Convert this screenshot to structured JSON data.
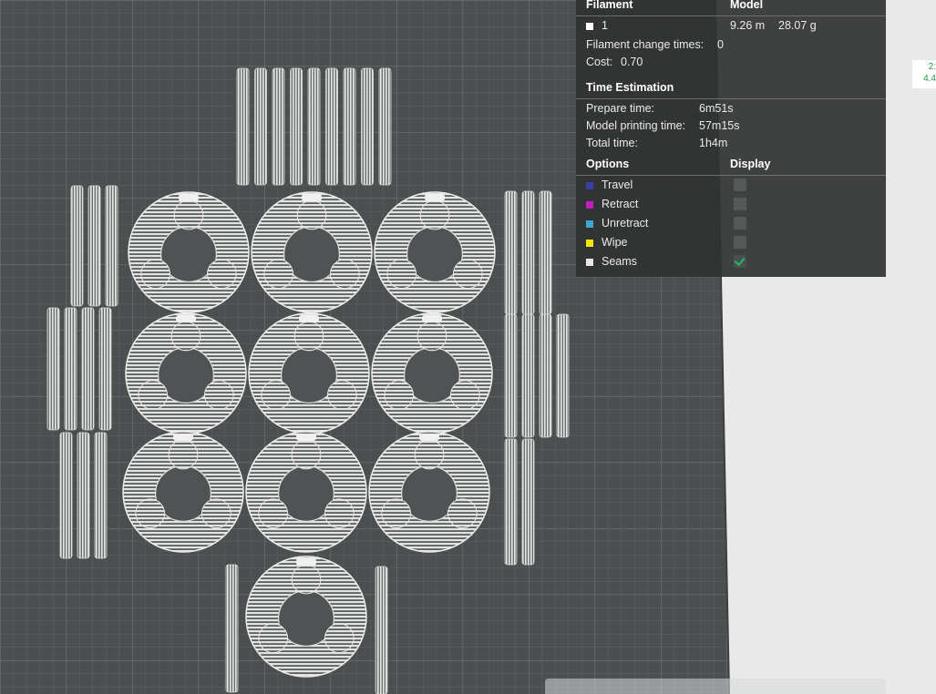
{
  "legend": {
    "filament_header": "Filament",
    "model_header": "Model",
    "filament_id": "1",
    "filament_length": "9.26 m",
    "filament_weight": "28.07 g",
    "filament_change_label": "Filament change times:",
    "filament_change_value": "0",
    "cost_label": "Cost:",
    "cost_value": "0.70",
    "time_header": "Time Estimation",
    "prepare_label": "Prepare time:",
    "prepare_value": "6m51s",
    "model_time_label": "Model printing time:",
    "model_time_value": "57m15s",
    "total_label": "Total time:",
    "total_value": "1h4m",
    "options_header": "Options",
    "display_header": "Display",
    "options": [
      {
        "label": "Travel",
        "color": "#3a3fa8",
        "checked": false
      },
      {
        "label": "Retract",
        "color": "#c21ec2",
        "checked": false
      },
      {
        "label": "Unretract",
        "color": "#3aa7d4",
        "checked": false
      },
      {
        "label": "Wipe",
        "color": "#f2e600",
        "checked": false
      },
      {
        "label": "Seams",
        "color": "#e6e6e6",
        "checked": true
      }
    ]
  },
  "side_readout": {
    "line1": "2:",
    "line2": "4.4"
  },
  "colors": {
    "bed": "#4c5050",
    "grid_minor": "#5f6464",
    "grid_major": "#6e7373",
    "print": "#e8e8e8",
    "accent": "#1dbb63"
  }
}
